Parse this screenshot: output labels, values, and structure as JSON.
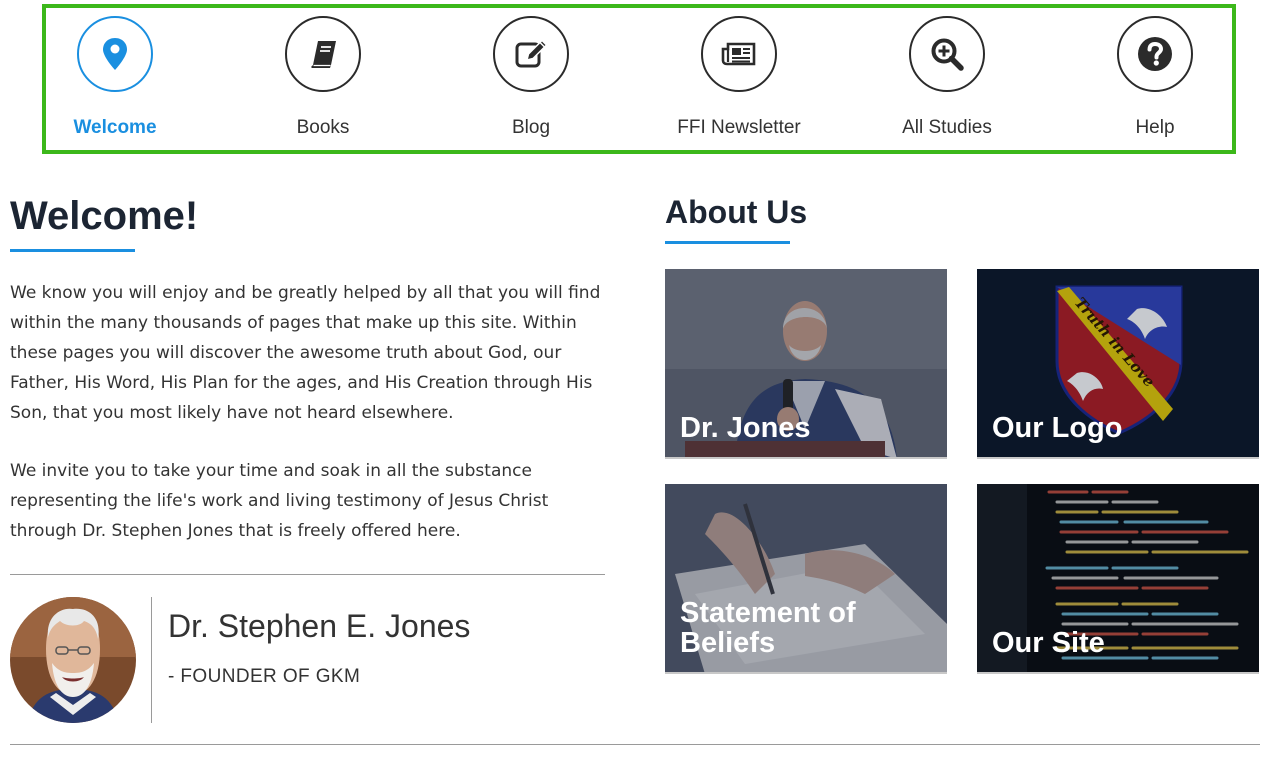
{
  "nav": {
    "items": [
      {
        "label": "Welcome",
        "icon": "map-marker-icon",
        "active": true
      },
      {
        "label": "Books",
        "icon": "book-icon",
        "active": false
      },
      {
        "label": "Blog",
        "icon": "edit-icon",
        "active": false
      },
      {
        "label": "FFI Newsletter",
        "icon": "newspaper-icon",
        "active": false
      },
      {
        "label": "All Studies",
        "icon": "search-plus-icon",
        "active": false
      },
      {
        "label": "Help",
        "icon": "question-circle-icon",
        "active": false
      }
    ],
    "highlight_color": "#3cb81a",
    "active_color": "#1a8fe0"
  },
  "welcome": {
    "title": "Welcome!",
    "paragraph1": "We know you will enjoy and be greatly helped by all that you will find within the many thousands of pages that make up this site. Within these pages you will discover the awesome truth about God, our Father, His Word, His Plan for the ages, and His Creation through His Son, that you most likely have not heard elsewhere.",
    "paragraph2": "We invite you to take your time and soak in all the substance representing the life's work and living testimony of Jesus Christ through Dr. Stephen Jones that is freely offered here."
  },
  "author": {
    "name": "Dr. Stephen E. Jones",
    "role": "- FOUNDER OF GKM"
  },
  "about": {
    "title": "About Us",
    "cards": [
      {
        "label": "Dr. Jones"
      },
      {
        "label": "Our Logo"
      },
      {
        "label": "Statement of Beliefs"
      },
      {
        "label": "Our Site"
      }
    ]
  },
  "logo_motto": "Truth in Love"
}
